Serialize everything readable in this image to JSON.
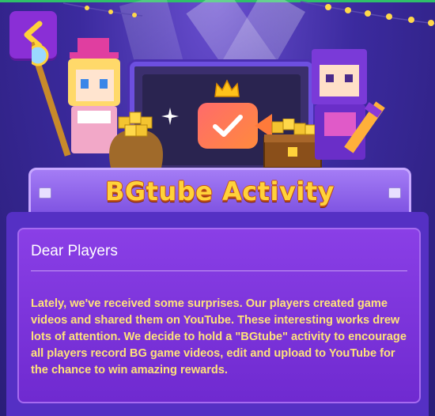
{
  "header": {
    "back_button_icon": "chevron-left-icon",
    "illustration_icons": [
      "crown-icon",
      "video-camera-icon",
      "checkmark-icon",
      "gold-cubes-icon",
      "treasure-chest-icon",
      "sparkle-icon"
    ]
  },
  "banner": {
    "title": "BGtube Activity"
  },
  "notice": {
    "title": "Dear Players",
    "body": "Lately, we've received some surprises. Our players created game videos and shared them on YouTube. These interesting works drew lots of attention. We decide to hold a \"BGtube\" activity to encourage all players record BG game videos, edit and upload to YouTube for the chance to win amazing rewards."
  },
  "colors": {
    "background": "#2a1e78",
    "accent_purple": "#8a2fd6",
    "banner_text": "#ffd23a",
    "body_text": "#ffe27a",
    "card": "#7a34db"
  }
}
